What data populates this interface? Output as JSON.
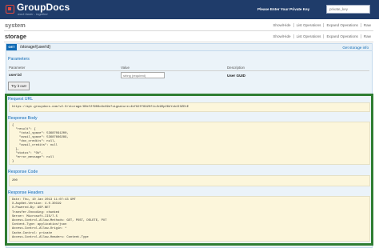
{
  "header": {
    "logo_text": "GroupDocs",
    "logo_tagline": "work faster - together",
    "key_label": "Please Enter Your Private Key",
    "key_placeholder": "private_key"
  },
  "resources": [
    {
      "title": "system",
      "links": [
        "Show/Hide",
        "List Operations",
        "Expand Operations",
        "Raw"
      ]
    },
    {
      "title": "storage",
      "links": [
        "Show/Hide",
        "List Operations",
        "Expand Operations",
        "Raw"
      ]
    }
  ],
  "operation": {
    "method": "GET",
    "path": "/storage/{userId}",
    "summary": "Get storage info"
  },
  "parameters": {
    "title": "Parameters",
    "columns": [
      "Parameter",
      "Value",
      "Description"
    ],
    "rows": [
      {
        "name": "userId",
        "placeholder": "string (required)",
        "description": "User GUID"
      }
    ]
  },
  "try_button": "Try it out!",
  "request_url": {
    "title": "Request URL",
    "value": "https://api.groupdocs.com/v2.0/storage/60ef2f908c9c69e?signature=4kf92ff6920f1iJk9Dp26kYzb4I3ZDtE"
  },
  "response_body": {
    "title": "Response Body",
    "lines": [
      "{",
      "  \"result\": {",
      "    \"total_space\": 53687091200,",
      "    \"avail_space\": 53687666289,",
      "    \"doc_credits\": null,",
      "    \"avail_credits\": null",
      "  },",
      "  \"status\": \"Ok\",",
      "  \"error_message\": null",
      "}"
    ]
  },
  "response_code": {
    "title": "Response Code",
    "value": "200"
  },
  "response_headers": {
    "title": "Response Headers",
    "lines": [
      "Date: Thu, 10 Jan 2013 11:07:43 GMT",
      "X-AspNet-Version: 4.0.30319",
      "X-Powered-By: ASP.NET",
      "Transfer-Encoding: chunked",
      "Server: Microsoft-IIS/7.5",
      "Access-Control-Allow-Methods: GET, POST, DELETE, PUT",
      "Content-Type: application/json",
      "Access-Control-Allow-Origin: *",
      "Cache-Control: private",
      "Access-Control-Allow-Headers: Content-Type"
    ]
  }
}
